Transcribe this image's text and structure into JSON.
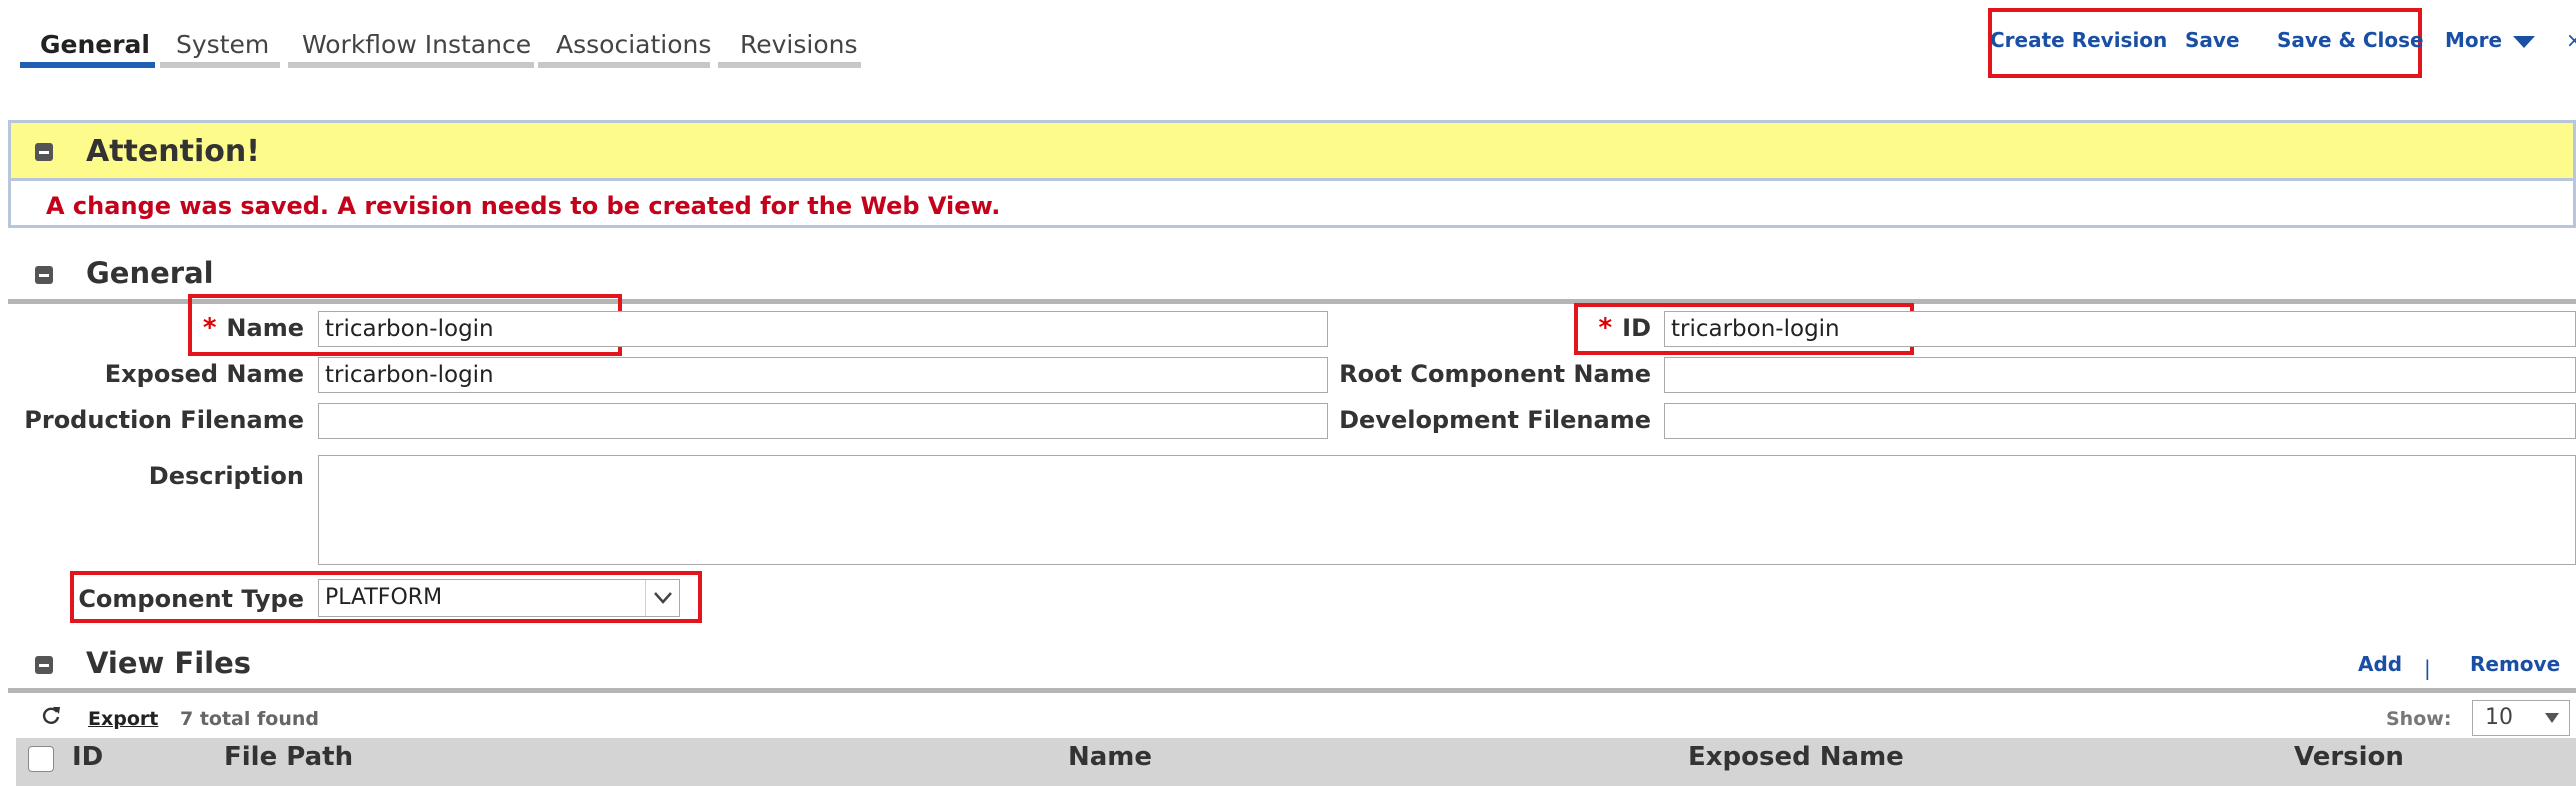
{
  "tabs": [
    {
      "label": "General",
      "active": true
    },
    {
      "label": "System",
      "active": false
    },
    {
      "label": "Workflow Instance",
      "active": false
    },
    {
      "label": "Associations",
      "active": false
    },
    {
      "label": "Revisions",
      "active": false
    }
  ],
  "toolbar": {
    "create_revision": "Create Revision",
    "save": "Save",
    "save_close": "Save & Close",
    "more": "More",
    "close_glyph": "×"
  },
  "attention": {
    "title": "Attention!",
    "message": "A change was saved. A revision needs to be created for the Web View."
  },
  "general": {
    "title": "General",
    "required_mark": "*",
    "name": {
      "label": "Name",
      "value": "tricarbon-login"
    },
    "id": {
      "label": "ID",
      "value": "tricarbon-login"
    },
    "exposed_name": {
      "label": "Exposed Name",
      "value": "tricarbon-login"
    },
    "root_component_name": {
      "label": "Root Component Name",
      "value": ""
    },
    "production_filename": {
      "label": "Production Filename",
      "value": ""
    },
    "development_filename": {
      "label": "Development Filename",
      "value": ""
    },
    "description": {
      "label": "Description",
      "value": ""
    },
    "component_type": {
      "label": "Component Type",
      "value": "PLATFORM"
    }
  },
  "view_files": {
    "title": "View Files",
    "add": "Add",
    "separator": "|",
    "remove": "Remove",
    "export": "Export",
    "total": "7 total found",
    "show_label": "Show:",
    "page_size": "10",
    "columns": [
      "ID",
      "File Path",
      "Name",
      "Exposed Name",
      "Version"
    ]
  },
  "colors": {
    "accent": "#1f5fb4",
    "link": "#1a4fa6",
    "attention_bg": "#fdfb8c",
    "error_text": "#c4001a",
    "highlight_box": "#e3151c",
    "grid_header": "#d4d4d4"
  }
}
